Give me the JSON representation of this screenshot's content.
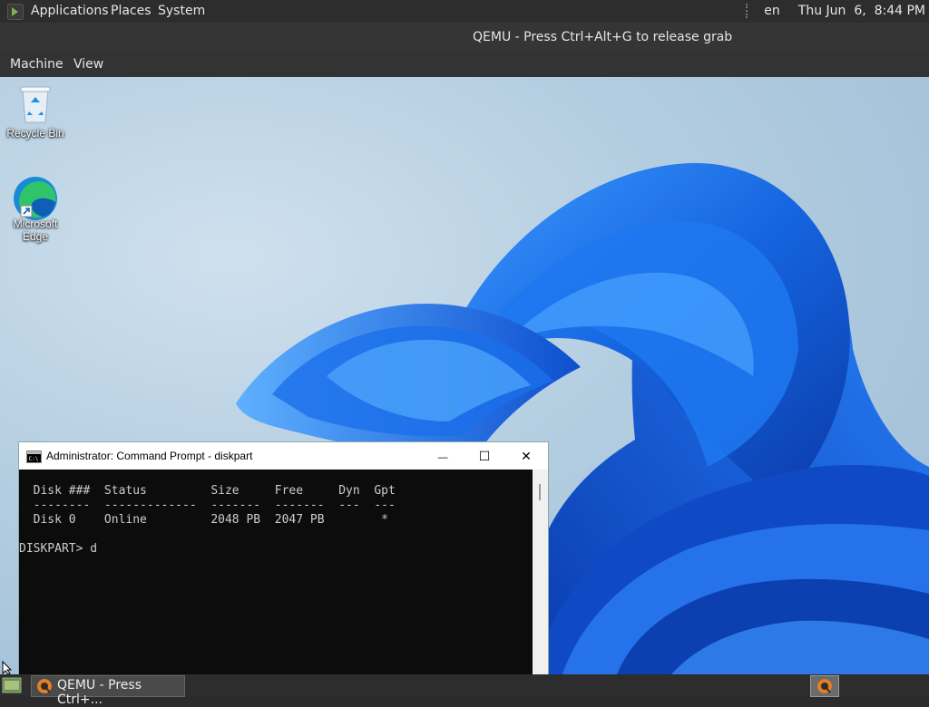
{
  "top_panel": {
    "menus": [
      "Applications",
      "Places",
      "System"
    ],
    "keyboard_layout": "en",
    "clock": "Thu Jun  6,  8:44 PM"
  },
  "qemu": {
    "title": "QEMU - Press Ctrl+Alt+G to release grab",
    "menus": [
      "Machine",
      "View"
    ]
  },
  "desktop": {
    "icons": [
      {
        "label": "Recycle Bin",
        "icon": "recycle-bin-icon"
      },
      {
        "label": "Microsoft Edge",
        "icon": "edge-icon"
      }
    ]
  },
  "cmd": {
    "title": "Administrator: Command Prompt - diskpart",
    "buttons": {
      "minimize": "—",
      "maximize": "☐",
      "close": "✕"
    },
    "lines": [
      "  Disk ###  Status         Size     Free     Dyn  Gpt",
      "  --------  -------------  -------  -------  ---  ---",
      "  Disk 0    Online         2048 PB  2047 PB        *",
      "",
      "DISKPART> d"
    ]
  },
  "taskbar": {
    "task_label": "QEMU - Press Ctrl+..."
  },
  "colors": {
    "wallpaper_bloom": "#1565e0",
    "panel_bg": "#2d2d2d",
    "cmd_bg": "#0c0c0c"
  }
}
